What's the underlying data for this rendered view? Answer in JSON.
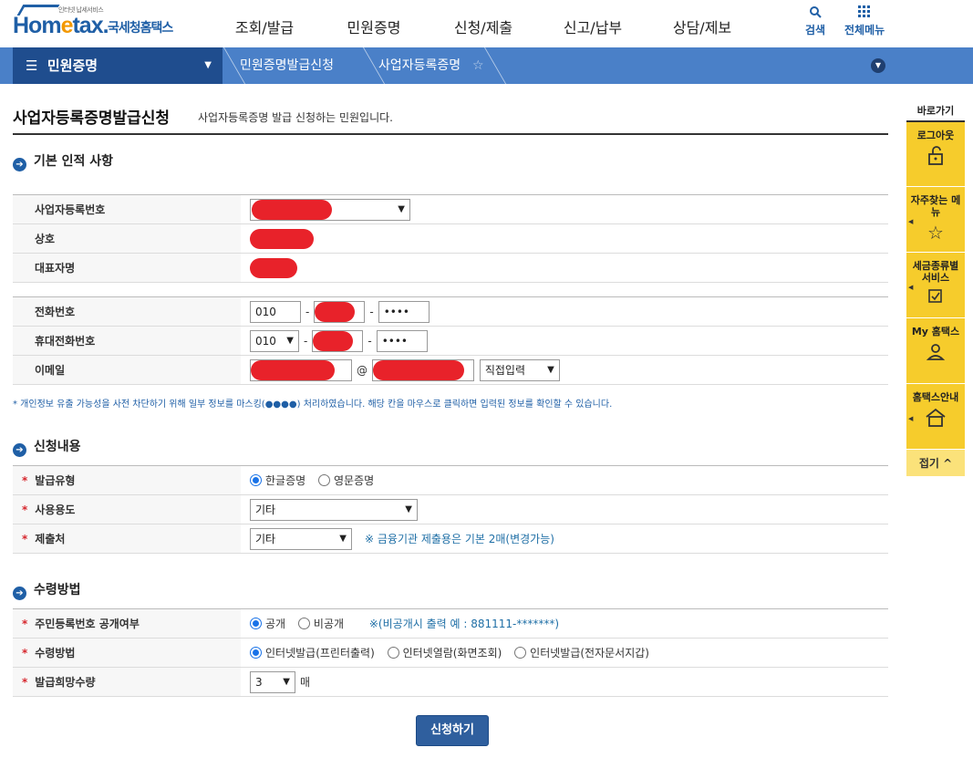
{
  "logo": {
    "sub": "인터넷 납세서비스",
    "hom": "Hom",
    "e": "e",
    "tax": "tax.",
    "nts": "국세청홈택스"
  },
  "gnb": [
    "조회/발급",
    "민원증명",
    "신청/제출",
    "신고/납부",
    "상담/제보"
  ],
  "tools": {
    "search": "검색",
    "menu": "전체메뉴",
    "search_icon": "search-icon",
    "menu_icon": "grid-icon"
  },
  "nav": {
    "first": "민원증명",
    "crumb1": "민원증명발급신청",
    "crumb2": "사업자등록증명",
    "star": "☆"
  },
  "page": {
    "title": "사업자등록증명발급신청",
    "desc": "사업자등록증명 발급 신청하는 민원입니다."
  },
  "sec1": {
    "title": "기본 인적 사항"
  },
  "basic": [
    {
      "label": "사업자등록번호"
    },
    {
      "label": "상호"
    },
    {
      "label": "대표자명"
    }
  ],
  "contact": {
    "phone_label": "전화번호",
    "phone_prefix": "010",
    "phone_last": "••••",
    "mobile_label": "휴대전화번호",
    "mobile_prefix": "010",
    "mobile_last": "••••",
    "email_label": "이메일",
    "at": "@",
    "email_domain": "직접입력"
  },
  "dash": "-",
  "mask_note": "* 개인정보 유출 가능성을 사전 차단하기 위해 일부 정보를 마스킹(●●●●) 처리하였습니다. 해당 칸을 마우스로 클릭하면 입력된 정보를 확인할 수 있습니다.",
  "sec2": {
    "title": "신청내용"
  },
  "req": "*",
  "apply": {
    "type_label": "발급유형",
    "type_opt1": "한글증명",
    "type_opt2": "영문증명",
    "use_label": "사용용도",
    "use_value": "기타",
    "dest_label": "제출처",
    "dest_value": "기타",
    "dest_hint": "※ 금융기관 제출용은 기본 2매(변경가능)"
  },
  "sec3": {
    "title": "수령방법"
  },
  "receive": {
    "rrn_label": "주민등록번호 공개여부",
    "rrn_opt1": "공개",
    "rrn_opt2": "비공개",
    "rrn_hint": "※(비공개시 출력 예 : 881111-*******)",
    "method_label": "수령방법",
    "method_opt1": "인터넷발급(프린터출력)",
    "method_opt2": "인터넷열람(화면조회)",
    "method_opt3": "인터넷발급(전자문서지갑)",
    "qty_label": "발급희망수량",
    "qty_value": "3",
    "qty_unit": "매"
  },
  "submit": "신청하기",
  "quick": {
    "title": "바로가기",
    "items": [
      {
        "label": "로그아웃",
        "icon": "lock-icon"
      },
      {
        "label": "자주찾는 메뉴",
        "icon": "star-icon"
      },
      {
        "label": "세금종류별 서비스",
        "icon": "checkbox-icon"
      },
      {
        "label": "My 홈택스",
        "icon": "person-icon"
      },
      {
        "label": "홈택스안내",
        "icon": "house-icon"
      }
    ],
    "fold": "접기 ^"
  },
  "colors": {
    "brand": "#1f5fa6",
    "navbar": "#4a80c8",
    "quick": "#f6cc2c",
    "required": "#d6262d"
  }
}
